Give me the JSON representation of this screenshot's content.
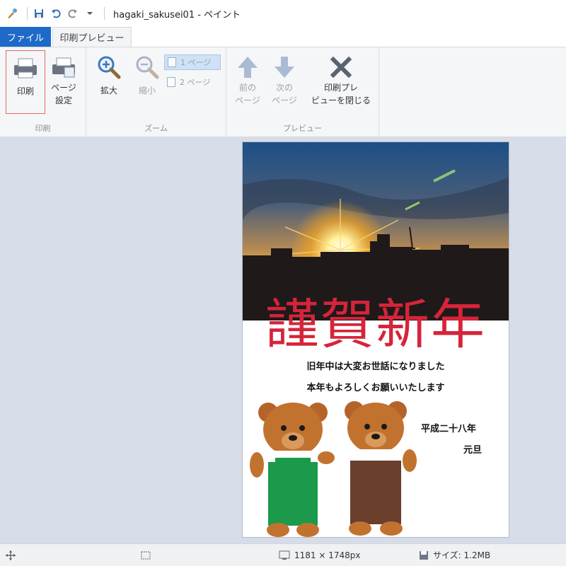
{
  "window": {
    "title": "hagaki_sakusei01 - ペイント"
  },
  "tabs": {
    "file": "ファイル",
    "print_preview": "印刷プレビュー"
  },
  "ribbon": {
    "print_group": {
      "label": "印刷",
      "print_button": "印刷",
      "page_setup_button_line1": "ページ",
      "page_setup_button_line2": "設定"
    },
    "zoom_group": {
      "label": "ズーム",
      "zoom_in": "拡大",
      "zoom_out": "縮小",
      "one_page": "1 ページ",
      "two_page": "2 ページ"
    },
    "preview_group": {
      "label": "プレビュー",
      "prev_line1": "前の",
      "prev_line2": "ページ",
      "next_line1": "次の",
      "next_line2": "ページ",
      "close_line1": "印刷プレ",
      "close_line2": "ビューを閉じる"
    }
  },
  "postcard": {
    "greeting": "謹賀新年",
    "message_line1": "旧年中は大変お世話になりました",
    "message_line2": "本年もよろしくお願いいたします",
    "date": "平成二十八年",
    "gantan": "元旦"
  },
  "status": {
    "dimensions": "1181 × 1748px",
    "size": "サイズ: 1.2MB"
  },
  "colors": {
    "accent": "#1e6ac8",
    "greeting_red": "#d6243a",
    "workspace": "#d6dde9"
  }
}
